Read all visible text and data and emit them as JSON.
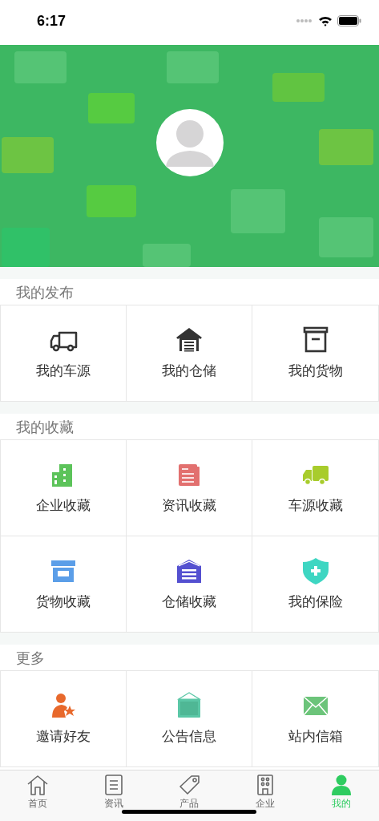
{
  "status_bar": {
    "time": "6:17"
  },
  "sections": [
    {
      "title": "我的发布",
      "items": [
        {
          "label": "我的车源",
          "kind": "truck",
          "color": "#333333"
        },
        {
          "label": "我的仓储",
          "kind": "warehouse",
          "color": "#333333"
        },
        {
          "label": "我的货物",
          "kind": "box",
          "color": "#333333"
        }
      ]
    },
    {
      "title": "我的收藏",
      "items": [
        {
          "label": "企业收藏",
          "kind": "building",
          "color": "#5cc35a"
        },
        {
          "label": "资讯收藏",
          "kind": "news",
          "color": "#e2706f"
        },
        {
          "label": "车源收藏",
          "kind": "truck-solid",
          "color": "#a8cc2c"
        },
        {
          "label": "货物收藏",
          "kind": "box-solid",
          "color": "#5b9ee8"
        },
        {
          "label": "仓储收藏",
          "kind": "warehouse-solid",
          "color": "#5450d0"
        },
        {
          "label": "我的保险",
          "kind": "shield",
          "color": "#3ed6c2"
        }
      ]
    },
    {
      "title": "更多",
      "items": [
        {
          "label": "邀请好友",
          "kind": "user-star",
          "color": "#e8692c"
        },
        {
          "label": "公告信息",
          "kind": "board",
          "color": "#5bc7a6"
        },
        {
          "label": "站内信箱",
          "kind": "mail",
          "color": "#6cc47a"
        }
      ]
    }
  ],
  "tabs": [
    {
      "label": "首页",
      "kind": "home",
      "selected": false
    },
    {
      "label": "资讯",
      "kind": "list",
      "selected": false
    },
    {
      "label": "产品",
      "kind": "tag",
      "selected": false
    },
    {
      "label": "企业",
      "kind": "building",
      "selected": false
    },
    {
      "label": "我的",
      "kind": "person",
      "selected": true
    }
  ]
}
